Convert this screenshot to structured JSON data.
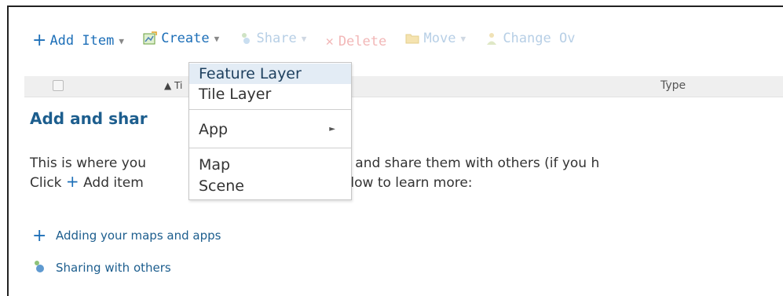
{
  "toolbar": {
    "add_item": "Add Item",
    "create": "Create",
    "share": "Share",
    "delete": "Delete",
    "move": "Move",
    "change_owner": "Change Ov"
  },
  "table_header": {
    "title_partial": "Ti",
    "type": "Type"
  },
  "content": {
    "heading": "Add and shar",
    "line1_a": "This is where you",
    "line1_b": "os and apps and share them with others (if you h",
    "line2_a": "Click",
    "line2_b": "Add item",
    "line2_c": "nt or click a link below to learn more:",
    "links": [
      {
        "label": "Adding your maps and apps",
        "icon": "plus-icon"
      },
      {
        "label": "Sharing with others",
        "icon": "share-icon"
      }
    ]
  },
  "create_menu": {
    "items": [
      "Feature Layer",
      "Tile Layer",
      "App",
      "Map",
      "Scene"
    ]
  },
  "colors": {
    "accent": "#1d6fb8",
    "heading": "#1d5e8e",
    "menu_highlight": "#e3ecf5"
  }
}
